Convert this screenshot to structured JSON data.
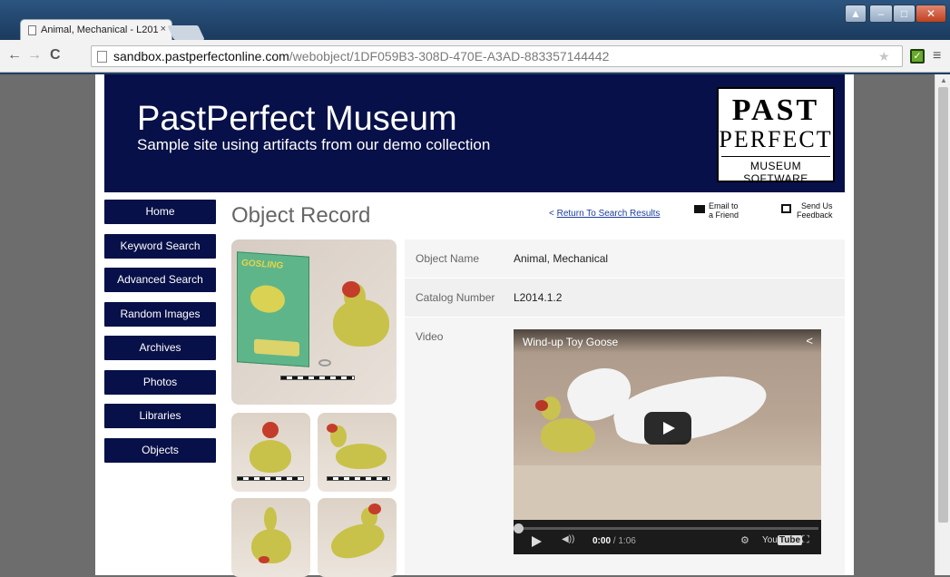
{
  "browser": {
    "tab_title": "Animal, Mechanical - L201",
    "tab_close": "×",
    "url_host": "sandbox.pastperfectonline.com",
    "url_path": "/webobject/1DF059B3-308D-470E-A3AD-883357144442",
    "window_buttons": [
      "▲",
      "–",
      "□",
      "✕"
    ]
  },
  "banner": {
    "title": "PastPerfect Museum",
    "subtitle": "Sample site using artifacts from our demo collection",
    "logo": [
      "PAST",
      "PERFECT",
      "MUSEUM SOFTWARE"
    ]
  },
  "nav": [
    "Home",
    "Keyword Search",
    "Advanced Search",
    "Random Images",
    "Archives",
    "Photos",
    "Libraries",
    "Objects"
  ],
  "record": {
    "title": "Object Record",
    "return_prefix": "<",
    "return_link": "Return To Search Results",
    "email_line1": "Email to",
    "email_line2": "a Friend",
    "feedback_line1": "Send Us",
    "feedback_line2": "Feedback",
    "fields": [
      {
        "label": "Object Name",
        "value": "Animal, Mechanical"
      },
      {
        "label": "Catalog Number",
        "value": "L2014.1.2"
      },
      {
        "label": "Video",
        "value": ""
      }
    ]
  },
  "video": {
    "title": "Wind-up Toy Goose",
    "time_current": "0:00",
    "time_total": " / 1:06",
    "progress": 0,
    "youtube_you": "You",
    "youtube_tube": "Tube"
  },
  "box_text": "GOSLING",
  "icons": [
    "back-icon",
    "forward-icon",
    "reload-icon",
    "page-icon",
    "star-icon",
    "extension-icon",
    "menu-icon",
    "mail-icon",
    "feedback-icon",
    "share-icon",
    "play-icon",
    "volume-icon",
    "settings-icon",
    "fullscreen-icon"
  ]
}
